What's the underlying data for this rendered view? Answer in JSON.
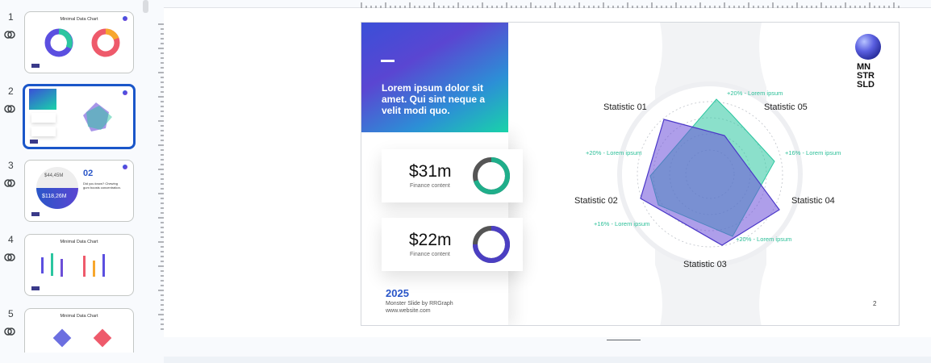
{
  "thumbnails": [
    {
      "number": "1",
      "title": "Minimal Data Chart",
      "selected": false
    },
    {
      "number": "2",
      "title": "",
      "selected": true
    },
    {
      "number": "3",
      "title": "",
      "selected": false,
      "value_a": "$44,45M",
      "value_b": "$118,26M",
      "heading": "02",
      "caption": "Did you know? Chewing gum boosts concentration."
    },
    {
      "number": "4",
      "title": "Minimal Data Chart",
      "selected": false
    },
    {
      "number": "5",
      "title": "Minimal Data Chart",
      "selected": false
    }
  ],
  "slide": {
    "hero_text": "Lorem ipsum dolor sit amet. Qui sint neque a velit modi quo.",
    "cards": [
      {
        "value": "$31m",
        "sub": "Finance content",
        "ring_color": "#1fae8a",
        "fill": 0.7
      },
      {
        "value": "$22m",
        "sub": "Finance content",
        "ring_color": "#4b3fc2",
        "fill": 0.75
      }
    ],
    "year": "2025",
    "credit": "Monster Slide by RRGraph",
    "site": "www.website.com",
    "page_number": "2",
    "brand": [
      "MN",
      "STR",
      "SLD"
    ],
    "radar": {
      "labels": [
        "Statistic 01",
        "Statistic 05",
        "Statistic 04",
        "Statistic 03",
        "Statistic 02"
      ],
      "percent_labels": [
        "+20% - Lorem ipsum",
        "+16% - Lorem ipsum",
        "+20% - Lorem ipsum",
        "+16% - Lorem ipsum",
        "+20% - Lorem ipsum"
      ],
      "colors": {
        "purple": "#6c4fd8",
        "teal": "#2bc6a0"
      }
    }
  }
}
